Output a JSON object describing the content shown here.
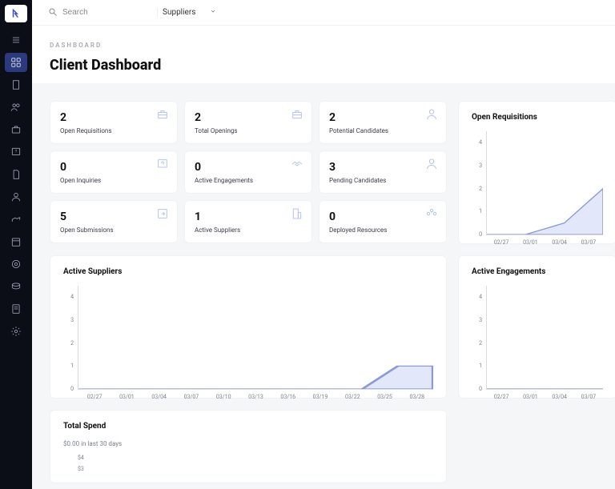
{
  "sidebar": {
    "logo": "logo",
    "items": [
      {
        "name": "nav-list",
        "active": false
      },
      {
        "name": "nav-dashboard",
        "active": true
      },
      {
        "name": "nav-building",
        "active": false
      },
      {
        "name": "nav-team",
        "active": false
      },
      {
        "name": "nav-briefcase",
        "active": false
      },
      {
        "name": "nav-inquiry",
        "active": false
      },
      {
        "name": "nav-document",
        "active": false
      },
      {
        "name": "nav-user",
        "active": false
      },
      {
        "name": "nav-deploy",
        "active": false
      },
      {
        "name": "nav-calendar",
        "active": false
      },
      {
        "name": "nav-target",
        "active": false
      },
      {
        "name": "nav-coin",
        "active": false
      },
      {
        "name": "nav-report",
        "active": false
      },
      {
        "name": "nav-settings",
        "active": false
      }
    ]
  },
  "topbar": {
    "search_placeholder": "Search",
    "category_label": "Suppliers"
  },
  "breadcrumb": "DASHBOARD",
  "page_title": "Client Dashboard",
  "stats": [
    {
      "value": "2",
      "label": "Open Requisitions",
      "icon": "briefcase"
    },
    {
      "value": "2",
      "label": "Total Openings",
      "icon": "briefcase"
    },
    {
      "value": "2",
      "label": "Potential Candidates",
      "icon": "person"
    },
    {
      "value": "0",
      "label": "Open Inquiries",
      "icon": "inquiry"
    },
    {
      "value": "0",
      "label": "Active Engagements",
      "icon": "handshake"
    },
    {
      "value": "3",
      "label": "Pending Candidates",
      "icon": "person"
    },
    {
      "value": "5",
      "label": "Open Submissions",
      "icon": "submit"
    },
    {
      "value": "1",
      "label": "Active Suppliers",
      "icon": "building"
    },
    {
      "value": "0",
      "label": "Deployed Resources",
      "icon": "team"
    }
  ],
  "chart_data": [
    {
      "id": "open-requisitions-chart",
      "title": "Open Requisitions",
      "type": "area",
      "ylim": [
        0,
        4.5
      ],
      "yticks": [
        0,
        1,
        2,
        3,
        4
      ],
      "categories": [
        "02/27",
        "03/01",
        "03/04",
        "03/07"
      ],
      "values": [
        0,
        0,
        0.5,
        2
      ]
    },
    {
      "id": "active-suppliers-chart",
      "title": "Active Suppliers",
      "type": "area",
      "ylim": [
        0,
        4.5
      ],
      "yticks": [
        0,
        1,
        2,
        3,
        4
      ],
      "categories": [
        "02/27",
        "03/01",
        "03/04",
        "03/07",
        "03/10",
        "03/13",
        "03/16",
        "03/19",
        "03/22",
        "03/25",
        "03/28"
      ],
      "values": [
        0,
        0,
        0,
        0,
        0,
        0,
        0,
        0,
        0,
        1,
        1
      ]
    },
    {
      "id": "active-engagements-chart",
      "title": "Active Engagements",
      "type": "area",
      "ylim": [
        0,
        4.5
      ],
      "yticks": [
        0,
        1,
        2,
        3,
        4
      ],
      "categories": [
        "02/27",
        "03/01",
        "03/04",
        "03/07"
      ],
      "values": [
        0,
        0,
        0,
        0
      ]
    }
  ],
  "total_spend": {
    "title": "Total Spend",
    "subtitle": "$0.00 in last 30 days",
    "yticks": [
      "$4",
      "$3"
    ]
  }
}
